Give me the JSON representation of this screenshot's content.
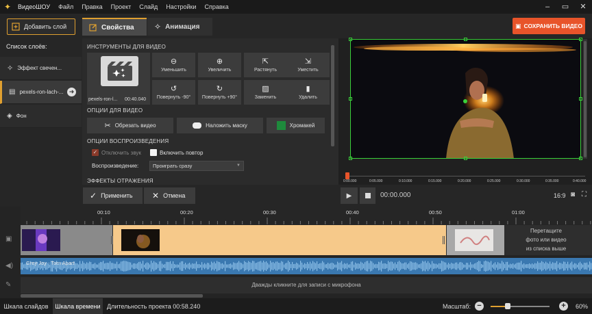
{
  "app": {
    "name": "ВидеоШОУ",
    "menu": [
      "Файл",
      "Правка",
      "Проект",
      "Слайд",
      "Настройки",
      "Справка"
    ]
  },
  "toolbar": {
    "add_layer": "Добавить слой",
    "tab_properties": "Свойства",
    "tab_animation": "Анимация",
    "save_video": "СОХРАНИТЬ ВИДЕО"
  },
  "layers": {
    "title": "Список слоёв:",
    "items": [
      {
        "label": "Эффект свечен..."
      },
      {
        "label": "pexels-ron-lach-..."
      },
      {
        "label": "Фон"
      }
    ]
  },
  "video_tools": {
    "title": "ИНСТРУМЕНТЫ ДЛЯ ВИДЕО",
    "clip_name": "pexels-ron-l...",
    "clip_duration": "00:40.040",
    "buttons": [
      {
        "label": "Уменьшить",
        "icon": "zoom-out-icon"
      },
      {
        "label": "Увеличить",
        "icon": "zoom-in-icon"
      },
      {
        "label": "Растянуть",
        "icon": "stretch-icon"
      },
      {
        "label": "Уместить",
        "icon": "fit-icon"
      },
      {
        "label": "Повернуть -90°",
        "icon": "rotate-left-icon"
      },
      {
        "label": "Повернуть +90°",
        "icon": "rotate-right-icon"
      },
      {
        "label": "Заменить",
        "icon": "replace-image-icon"
      },
      {
        "label": "Удалить",
        "icon": "trash-icon"
      }
    ]
  },
  "video_options": {
    "title": "ОПЦИИ ДЛЯ ВИДЕО",
    "crop": "Обрезать видео",
    "mask": "Наложить маску",
    "chroma": "Хромакей"
  },
  "playback_options": {
    "title": "ОПЦИИ ВОСПРОИЗВЕДЕНИЯ",
    "mute": "Отключить звук",
    "loop": "Включить повтор",
    "playback_label": "Воспроизведение:",
    "playback_value": "Проиграть сразу"
  },
  "reflection": {
    "title": "ЭФФЕКТЫ ОТРАЖЕНИЯ"
  },
  "preview": {
    "ruler_ticks": [
      "0:00.000",
      "0:05.000",
      "0:10.000",
      "0:15.000",
      "0:20.000",
      "0:25.000",
      "0:30.000",
      "0:35.000",
      "0:40.000"
    ],
    "timecode": "00:00.000",
    "aspect": "16:9"
  },
  "actions": {
    "apply": "Применить",
    "cancel": "Отмена"
  },
  "timeline": {
    "ruler": [
      "00:10",
      "00:20",
      "00:30",
      "00:40",
      "00:50",
      "01:00"
    ],
    "drop_hint": [
      "Перетащите",
      "фото или видео",
      "из списка выше"
    ],
    "audio_track": "Grey Joy - Torn Apart",
    "mic_hint": "Дважды кликните для записи с микрофона"
  },
  "statusbar": {
    "tab_slides": "Шкала слайдов",
    "tab_timeline": "Шкала времени",
    "duration": "Длительность проекта 00:58.240",
    "zoom_label": "Масштаб:",
    "zoom_value": "60%"
  },
  "colors": {
    "accent": "#e0a030",
    "save": "#e8542a",
    "chroma": "#1e8a3c",
    "selection": "#3ad13a",
    "audio": "#3a78b0"
  }
}
